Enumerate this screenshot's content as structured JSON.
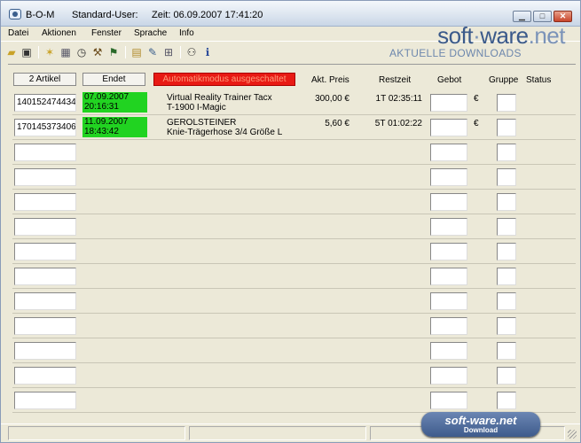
{
  "window": {
    "app_name": "B-O-M",
    "user": "Standard-User:",
    "time": "Zeit: 06.09.2007 17:41:20",
    "min_glyph": "▁",
    "max_glyph": "□",
    "close_glyph": "✕"
  },
  "menu": [
    "Datei",
    "Aktionen",
    "Fenster",
    "Sprache",
    "Info"
  ],
  "toolbar_icons": [
    "open-icon",
    "save-icon",
    "stars-icon",
    "image-icon",
    "clock-icon",
    "hammer-icon",
    "traffic-light-icon",
    "calendar-icon",
    "edit-icon",
    "network-icon",
    "group-icon",
    "info-icon"
  ],
  "watermark": {
    "brand_a": "soft",
    "brand_dot": "·",
    "brand_b": "ware",
    "brand_c": ".net",
    "subtitle": "AKTUELLE DOWNLOADS"
  },
  "header": {
    "articles_button": "2 Artikel",
    "ends_button": "Endet",
    "auto_mode_button": "Automatikmodus ausgeschaltet",
    "col_price": "Akt. Preis",
    "col_rest": "Restzeit",
    "col_bid": "Gebot",
    "col_group": "Gruppe",
    "col_status": "Status"
  },
  "rows": [
    {
      "id": "140152474434",
      "end_date": "07.09.2007",
      "end_time": "20:16:31",
      "name1": "Virtual Reality Trainer Tacx",
      "name2": "T-1900 I-Magic",
      "price": "300,00 €",
      "rest": "1T 02:35:11",
      "currency": "€"
    },
    {
      "id": "170145373406",
      "end_date": "11.09.2007",
      "end_time": "18:43:42",
      "name1": "GEROLSTEINER",
      "name2": "Knie-Trägerhose 3/4  Größe L",
      "price": "5,60 €",
      "rest": "5T 01:02:22",
      "currency": "€"
    }
  ],
  "empty_row_count": 11,
  "badge": {
    "main": "soft-ware.net",
    "sub": "Download"
  },
  "colors": {
    "green": "#21d321",
    "red": "#e81a14",
    "brand": "#3b5a8a"
  }
}
